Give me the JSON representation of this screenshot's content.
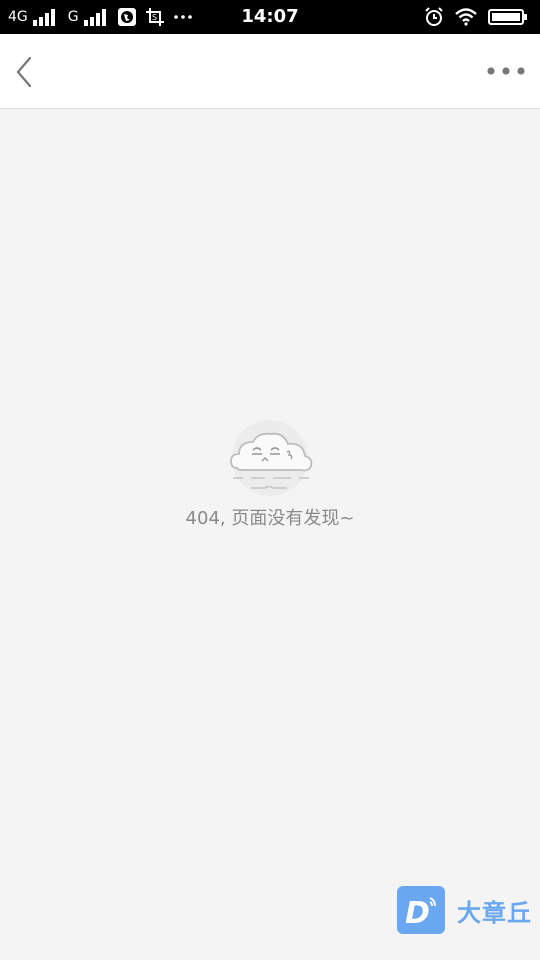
{
  "status_bar": {
    "network1": "4G",
    "network2": "G",
    "time": "14:07"
  },
  "nav": {
    "back_icon": "chevron-left-icon",
    "more_icon": "more-dots-icon"
  },
  "empty_state": {
    "illustration": "sad-cloud-icon",
    "message": "404, 页面没有发现~"
  },
  "watermark": {
    "logo": "D-logo",
    "text": "大章丘"
  },
  "colors": {
    "status_bar_bg": "#000000",
    "page_bg": "#f4f4f4",
    "nav_bg": "#ffffff",
    "message_text": "#8a8a8a",
    "watermark_blue": "#3d8ef0"
  }
}
